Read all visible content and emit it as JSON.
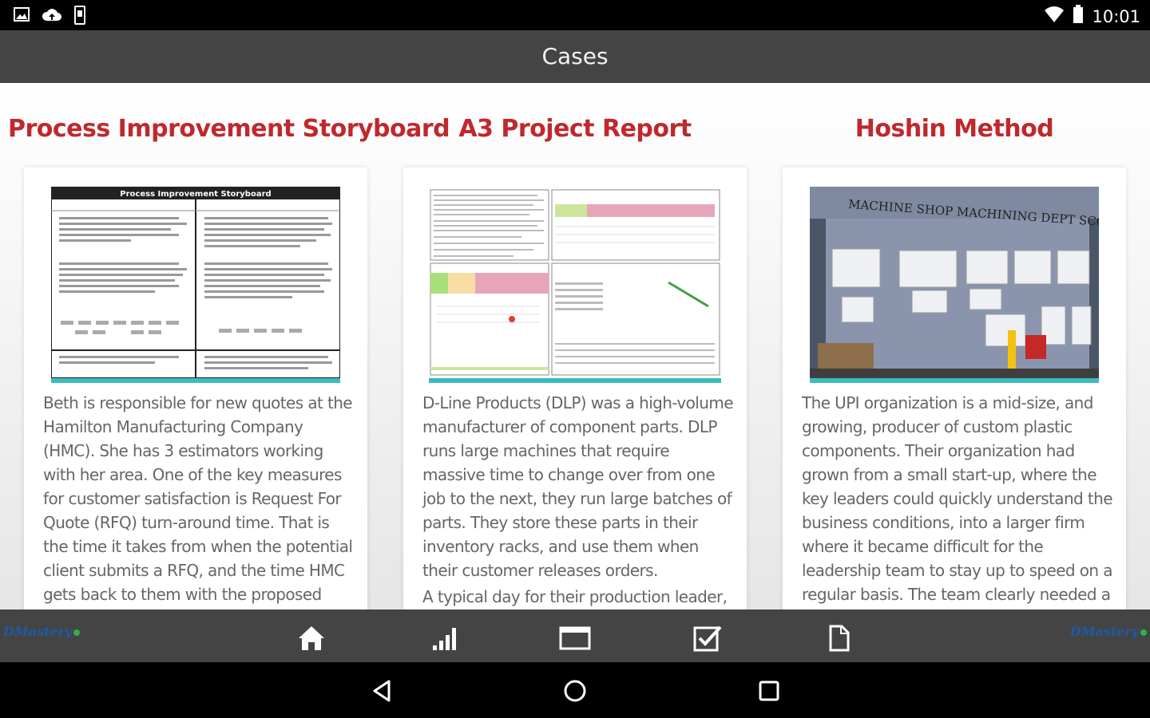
{
  "status_bar": {
    "time": "10:01",
    "left_icons": [
      "image-icon",
      "cloud-upload-icon",
      "phone-icon"
    ],
    "right_icons": [
      "wifi-icon",
      "battery-icon"
    ]
  },
  "app_bar": {
    "title": "Cases"
  },
  "cases": [
    {
      "title": "Process Improvement Storyboard",
      "thumb_label": "Process Improvement Storyboard",
      "description": "Beth is responsible for new quotes at the Hamilton Manufacturing Company (HMC). She has 3 estimators working with her area. One of the key measures for customer satisfaction is Request For Quote (RFQ) turn-around time. That is the time it takes from when the potential client submits a RFQ, and the time HMC gets back to them with the proposed"
    },
    {
      "title": "A3 Project Report",
      "thumb_label": "",
      "description": "D-Line Products (DLP) was a high-volume manufacturer of component parts. DLP runs large machines that require massive time to change over from one job to the next, they run large batches of parts. They store these parts in their inventory racks, and use them when their customer releases orders.",
      "description_2": "A typical day for their production leader,"
    },
    {
      "title": "Hoshin Method",
      "thumb_label": "MACHINE SHOP MACHINING DEPT SCOREBOARD",
      "description": "The UPI organization is a mid-size, and growing, producer of custom plastic components. Their organization had grown from a small start-up, where the key leaders could quickly understand the business conditions, into a larger firm where it became difficult for the leadership team to stay up to speed on a regular basis. The team clearly needed a"
    }
  ],
  "bottom_nav": {
    "logo_left": "DMastery",
    "logo_right": "DMastery",
    "items": [
      "home-icon",
      "bar-chart-icon",
      "window-icon",
      "checkbox-icon",
      "document-icon"
    ]
  },
  "system_nav": [
    "back-icon",
    "home-circle-icon",
    "recents-icon"
  ],
  "colors": {
    "accent": "#c0282d",
    "bar": "#444444",
    "teal": "#3bbcc0"
  }
}
